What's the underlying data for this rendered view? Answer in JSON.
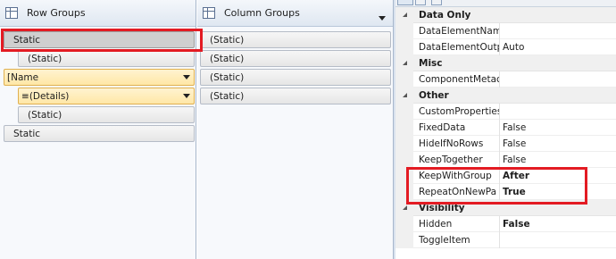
{
  "row_groups": {
    "title": "Row Groups",
    "cells": [
      {
        "label": "Static"
      },
      {
        "label": "(Static)"
      },
      {
        "label": "Name",
        "prefix": "[ "
      },
      {
        "label": "(Details)",
        "prefix": "≡ "
      },
      {
        "label": "(Static)"
      },
      {
        "label": "Static"
      }
    ]
  },
  "column_groups": {
    "title": "Column Groups",
    "cells": [
      "(Static)",
      "(Static)",
      "(Static)",
      "(Static)"
    ]
  },
  "properties": {
    "categories": [
      {
        "name": "Data Only",
        "rows": [
          {
            "name": "DataElementNam",
            "value": ""
          },
          {
            "name": "DataElementOutp",
            "value": "Auto"
          }
        ]
      },
      {
        "name": "Misc",
        "rows": [
          {
            "name": "ComponentMetac",
            "value": ""
          }
        ]
      },
      {
        "name": "Other",
        "rows": [
          {
            "name": "CustomProperties",
            "value": ""
          },
          {
            "name": "FixedData",
            "value": "False"
          },
          {
            "name": "HideIfNoRows",
            "value": "False"
          },
          {
            "name": "KeepTogether",
            "value": "False"
          },
          {
            "name": "KeepWithGroup",
            "value": "After"
          },
          {
            "name": "RepeatOnNewPa",
            "value": "True"
          }
        ]
      },
      {
        "name": "Visibility",
        "rows": [
          {
            "name": "Hidden",
            "value": "False"
          },
          {
            "name": "ToggleItem",
            "value": ""
          }
        ]
      }
    ]
  },
  "colors": {
    "highlight": "#e31b23",
    "selected_group": "#cfcfcf",
    "group_yellow": "#ffe7a6"
  }
}
